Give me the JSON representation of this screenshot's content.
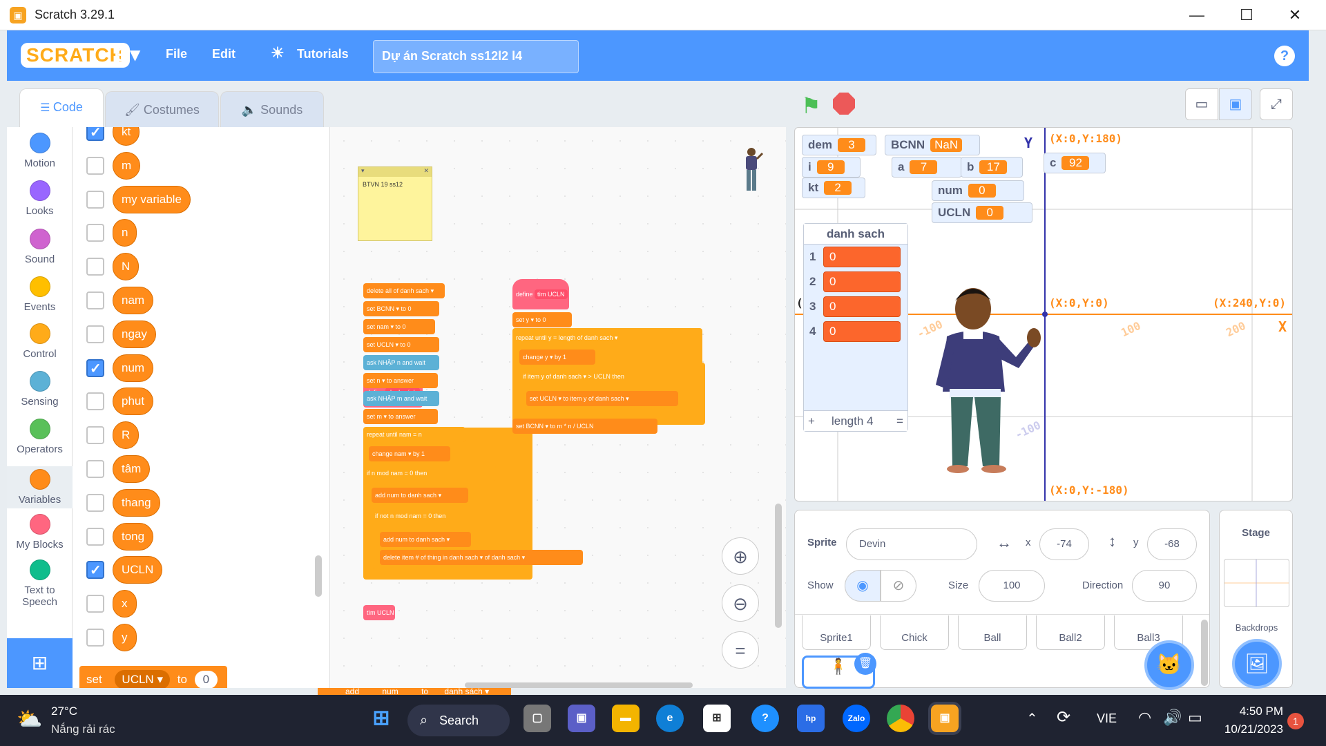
{
  "window": {
    "title": "Scratch 3.29.1"
  },
  "menu": {
    "file": "File",
    "edit": "Edit",
    "tutorials": "Tutorials",
    "project_title": "Dự án Scratch ss12l2 l4",
    "logo": "SCRATCH"
  },
  "tabs": {
    "code": "Code",
    "costumes": "Costumes",
    "sounds": "Sounds"
  },
  "categories": [
    {
      "label": "Motion",
      "color": "#4c97ff"
    },
    {
      "label": "Looks",
      "color": "#9966ff"
    },
    {
      "label": "Sound",
      "color": "#cf63cf"
    },
    {
      "label": "Events",
      "color": "#ffbf00"
    },
    {
      "label": "Control",
      "color": "#ffab19"
    },
    {
      "label": "Sensing",
      "color": "#5cb1d6"
    },
    {
      "label": "Operators",
      "color": "#59c059"
    },
    {
      "label": "Variables",
      "color": "#ff8c1a"
    },
    {
      "label": "My Blocks",
      "color": "#ff6680"
    },
    {
      "label": "Text to Speech",
      "color": "#0fbd8c"
    }
  ],
  "variables": [
    {
      "name": "kt",
      "checked": true
    },
    {
      "name": "m",
      "checked": false
    },
    {
      "name": "my variable",
      "checked": false
    },
    {
      "name": "n",
      "checked": false
    },
    {
      "name": "N",
      "checked": false
    },
    {
      "name": "nam",
      "checked": false
    },
    {
      "name": "ngay",
      "checked": false
    },
    {
      "name": "num",
      "checked": true
    },
    {
      "name": "phut",
      "checked": false
    },
    {
      "name": "R",
      "checked": false
    },
    {
      "name": "tâm",
      "checked": false
    },
    {
      "name": "thang",
      "checked": false
    },
    {
      "name": "tong",
      "checked": false
    },
    {
      "name": "UCLN",
      "checked": true
    },
    {
      "name": "x",
      "checked": false
    },
    {
      "name": "y",
      "checked": false
    }
  ],
  "palette_set": {
    "set": "set",
    "var": "UCLN",
    "to": "to",
    "value": "0"
  },
  "note": {
    "text": "BTVN 19 ss12"
  },
  "script1": {
    "define": "define",
    "name": "danh sách",
    "l1": "delete all of  danh sach ▾",
    "l2": "set  BCNN ▾  to  0",
    "l3": "set  nam ▾  to  0",
    "l4": "set  UCLN ▾  to  0",
    "l5": "ask  NHẬP n  and wait",
    "l6": "set  n ▾  to  answer",
    "l7": "ask  NHẬP m  and wait",
    "l8": "set  m ▾  to  answer",
    "l9": "repeat until   nam  =  n",
    "l10": "change  nam ▾  by  1",
    "l11": "if    n  mod  nam  =  0   then",
    "l12": "add  num  to  danh sach ▾",
    "l13": "if   not   n  mod  nam  =  0   then",
    "l14": "add  num  to  danh sach ▾",
    "l15": "delete  item # of  thing  in  danh sach ▾  of  danh sach ▾",
    "call": "tìm UCLN"
  },
  "script2": {
    "define": "define",
    "name": "tìm UCLN",
    "l1": "set  y ▾  to  0",
    "l2": "repeat until   y  =  length of  danh sach ▾",
    "l3": "change  y ▾  by  1",
    "l4": "if   item  y  of  danh sach ▾  >  UCLN   then",
    "l5": "set  UCLN ▾  to  item  y  of  danh sach ▾",
    "l6": "set  BCNN ▾  to   m  *  n  /  UCLN"
  },
  "monitors": [
    {
      "name": "dem",
      "value": "3"
    },
    {
      "name": "BCNN",
      "value": "NaN"
    },
    {
      "name": "i",
      "value": "9"
    },
    {
      "name": "a",
      "value": "7"
    },
    {
      "name": "b",
      "value": "17"
    },
    {
      "name": "c",
      "value": "92"
    },
    {
      "name": "kt",
      "value": "2"
    },
    {
      "name": "num",
      "value": "0"
    },
    {
      "name": "UCLN",
      "value": "0"
    }
  ],
  "list": {
    "title": "danh sach",
    "items": [
      "0",
      "0",
      "0",
      "0"
    ],
    "indexes": [
      "1",
      "2",
      "3",
      "4"
    ],
    "add": "+",
    "length": "length 4",
    "resize": "="
  },
  "axes": {
    "y_label": "Y",
    "x_label": "X",
    "top": "(X:0,Y:180)",
    "origin": "(X:0,Y:0)",
    "right": "(X:240,Y:0)",
    "bottom": "(X:0,Y:-180)",
    "t1": "-100",
    "t2": "100",
    "t3": "200",
    "t4": "-100",
    "left_paren": "("
  },
  "sprite_info": {
    "sprite_label": "Sprite",
    "sprite_name": "Devin",
    "x_label": "x",
    "x": "-74",
    "y_label": "y",
    "y": "-68",
    "show_label": "Show",
    "size_label": "Size",
    "size": "100",
    "direction_label": "Direction",
    "direction": "90"
  },
  "sprites": [
    "Sprite1",
    "Chick",
    "Ball",
    "Ball2",
    "Ball3"
  ],
  "stage_panel": {
    "title": "Stage",
    "backdrops": "Backdrops"
  },
  "taskbar": {
    "temp": "27°C",
    "weather": "Nắng rải rác",
    "search": "Search",
    "lang": "VIE",
    "time": "4:50 PM",
    "date": "10/21/2023",
    "notif": "1"
  },
  "bottom_strip": {
    "add": "add",
    "num": "num",
    "to": "to",
    "list": "danh sách ▾",
    "sprite": "Sprite",
    "sprite1": "Sprite1"
  }
}
